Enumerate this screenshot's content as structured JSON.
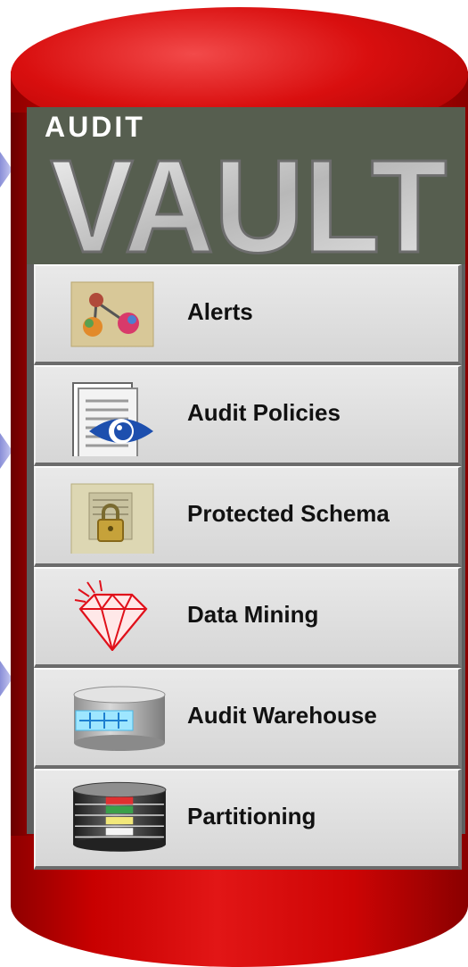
{
  "logo": {
    "small_text": "AUDIT",
    "big_text": "VAULT"
  },
  "menu": {
    "items": [
      {
        "label": "Alerts",
        "icon": "alerts-icon"
      },
      {
        "label": "Audit Policies",
        "icon": "document-eye-icon"
      },
      {
        "label": "Protected Schema",
        "icon": "padlock-icon"
      },
      {
        "label": "Data Mining",
        "icon": "diamond-icon"
      },
      {
        "label": "Audit Warehouse",
        "icon": "database-cylinder-icon"
      },
      {
        "label": "Partitioning",
        "icon": "partitioned-database-icon"
      }
    ]
  },
  "colors": {
    "cylinder": "#d40000",
    "panel": "#e2e2e2",
    "logo_bg": "#565e4f",
    "arrow": "#9fa3e2"
  }
}
